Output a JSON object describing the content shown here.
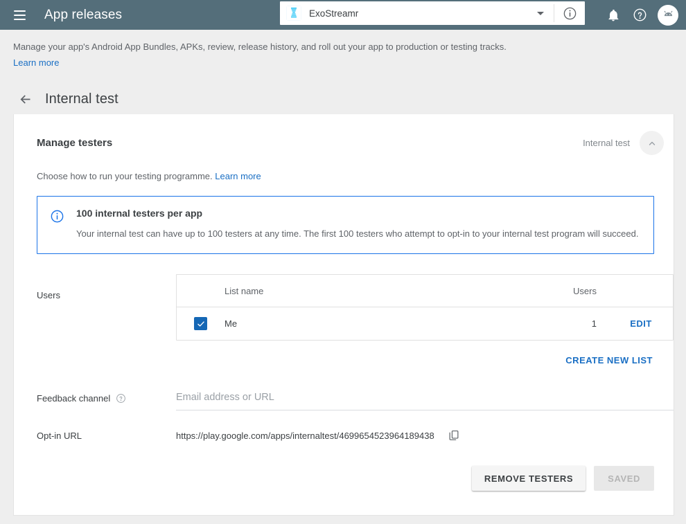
{
  "topbar": {
    "menu_icon": "hamburger-menu-icon",
    "title": "App releases",
    "app_selector": {
      "app_icon": "exostreamr-app-icon",
      "value": "ExoStreamr",
      "caret_icon": "chevron-down-icon"
    },
    "info_icon": "info-outline-icon",
    "notifications_icon": "bell-icon",
    "help_icon": "help-circle-icon",
    "avatar_icon": "android-avatar-icon",
    "background_color": "#546e7a"
  },
  "intro": {
    "text": "Manage your app's Android App Bundles, APKs, review, release history, and roll out your app to production or testing tracks.",
    "link_label": "Learn more"
  },
  "page": {
    "back_icon": "arrow-back-icon",
    "title": "Internal test"
  },
  "card": {
    "title": "Manage testers",
    "head_label": "Internal test",
    "collapse_icon": "chevron-up-icon",
    "subtitle_text": "Choose how to run your testing programme.",
    "subtitle_link": "Learn more",
    "callout": {
      "icon": "info-circle-icon",
      "title": "100 internal testers per app",
      "text": "Your internal test can have up to 100 testers at any time. The first 100 testers who attempt to opt-in to your internal test program will succeed.",
      "accent_color": "#1a73e8"
    },
    "users": {
      "label": "Users",
      "columns": {
        "list_name": "List name",
        "users": "Users"
      },
      "rows": [
        {
          "checked": true,
          "list_name": "Me",
          "users": "1",
          "edit_label": "EDIT"
        }
      ],
      "create_list_label": "CREATE NEW LIST",
      "checkbox_color": "#1567b5"
    },
    "feedback": {
      "label": "Feedback channel",
      "help_icon": "help-circle-outline-icon",
      "placeholder": "Email address or URL",
      "value": ""
    },
    "optin": {
      "label": "Opt-in URL",
      "url": "https://play.google.com/apps/internaltest/4699654523964189438",
      "copy_icon": "copy-icon"
    },
    "actions": {
      "remove_label": "REMOVE TESTERS",
      "saved_label": "SAVED"
    },
    "link_color": "#1a6fc4"
  }
}
